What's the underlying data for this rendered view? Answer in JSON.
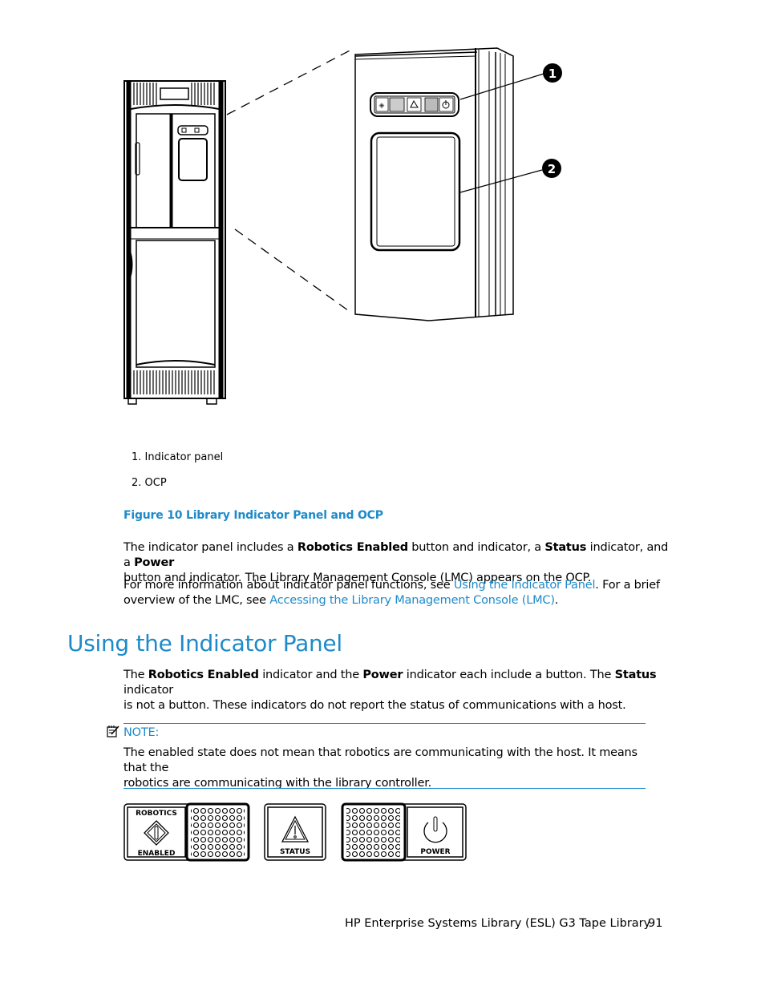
{
  "figure": {
    "callouts": [
      {
        "number": "1",
        "label": "Indicator panel"
      },
      {
        "number": "2",
        "label": "OCP"
      }
    ],
    "list_items": [
      "1. Indicator panel",
      "2. OCP"
    ],
    "title": "Figure 10 Library Indicator Panel and OCP"
  },
  "intro": {
    "p1": {
      "t1": "The indicator panel includes a ",
      "b1": "Robotics Enabled",
      "t2": " button and indicator, a ",
      "b2": "Status",
      "t3": " indicator, and a ",
      "b3": "Power",
      "t4": "button and indicator. The Library Management Console (LMC) appears on the OCP."
    },
    "p2": {
      "t1": "For more information about indicator panel functions, see ",
      "link1": "Using the Indicator Panel",
      "t2": ". For a brief",
      "t3": "overview of the LMC, see ",
      "link2": "Accessing the Library Management Console (LMC)",
      "t4": "."
    }
  },
  "section": {
    "heading": "Using the Indicator Panel",
    "p1": {
      "t1": "The ",
      "b1": "Robotics Enabled",
      "t2": " indicator and the ",
      "b2": "Power",
      "t3": " indicator each include a button. The ",
      "b3": "Status",
      "t4": " indicator",
      "t5": "is not a button. These indicators do not report the status of communications with a host."
    }
  },
  "note": {
    "icon": "note-icon",
    "label": "NOTE:",
    "line1": "The enabled state does not mean that robotics are communicating with the host. It means that the",
    "line2": "robotics are communicating with the library controller."
  },
  "indicators": {
    "robotics_top": "ROBOTICS",
    "robotics_bottom": "ENABLED",
    "status": "STATUS",
    "power": "POWER"
  },
  "footer": {
    "title": "HP Enterprise Systems Library (ESL) G3 Tape Library",
    "page": "91"
  }
}
